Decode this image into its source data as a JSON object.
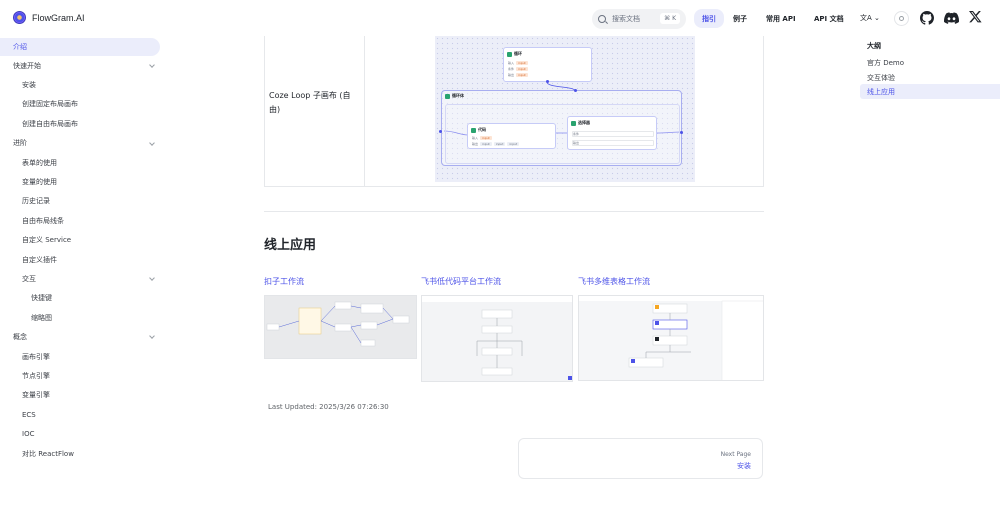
{
  "header": {
    "brand": "FlowGram.AI",
    "search_placeholder": "搜索文档",
    "search_shortcut": "⌘ K",
    "nav": [
      "指引",
      "例子",
      "常用 API",
      "API 文档"
    ],
    "lang_label": "文A ⌄"
  },
  "sidebar": {
    "items": [
      {
        "label": "介绍",
        "level": 0,
        "active": true
      },
      {
        "label": "快速开始",
        "level": 0,
        "chevron": true
      },
      {
        "label": "安装",
        "level": 1
      },
      {
        "label": "创建固定布局画布",
        "level": 1
      },
      {
        "label": "创建自由布局画布",
        "level": 1
      },
      {
        "label": "进阶",
        "level": 0,
        "chevron": true
      },
      {
        "label": "表单的使用",
        "level": 1
      },
      {
        "label": "变量的使用",
        "level": 1
      },
      {
        "label": "历史记录",
        "level": 1
      },
      {
        "label": "自由布局线条",
        "level": 1
      },
      {
        "label": "自定义 Service",
        "level": 1
      },
      {
        "label": "自定义插件",
        "level": 1
      },
      {
        "label": "交互",
        "level": 1,
        "chevron": true
      },
      {
        "label": "快捷键",
        "level": 2
      },
      {
        "label": "缩略图",
        "level": 2
      },
      {
        "label": "概念",
        "level": 0,
        "chevron": true
      },
      {
        "label": "画布引擎",
        "level": 1
      },
      {
        "label": "节点引擎",
        "level": 1
      },
      {
        "label": "变量引擎",
        "level": 1
      },
      {
        "label": "ECS",
        "level": 1
      },
      {
        "label": "IOC",
        "level": 1
      },
      {
        "label": "对比 ReactFlow",
        "level": 1
      }
    ]
  },
  "main": {
    "table_row_label": "Coze Loop 子画布 (自由)",
    "canvas": {
      "top_node_title": "循环",
      "loop_title": "循环体",
      "code_node_title": "代码",
      "selector_node_title": "选择器",
      "tag_text": "input",
      "port_labels": [
        "输入",
        "条件",
        "输出"
      ]
    },
    "section_title": "线上应用",
    "cards": [
      {
        "title": "扣子工作流"
      },
      {
        "title": "飞书低代码平台工作流"
      },
      {
        "title": "飞书多维表格工作流"
      }
    ],
    "last_updated": "Last Updated: 2025/3/26 07:26:30",
    "next_page_label": "Next Page",
    "next_page_title": "安装"
  },
  "outline": {
    "title": "大纲",
    "items": [
      {
        "label": "官方 Demo",
        "active": false
      },
      {
        "label": "交互体验",
        "active": false
      },
      {
        "label": "线上应用",
        "active": true
      }
    ]
  },
  "colors": {
    "accent": "#4d53e8",
    "accent_bg": "#ebedfb",
    "canvas_bg": "#eceef8"
  }
}
